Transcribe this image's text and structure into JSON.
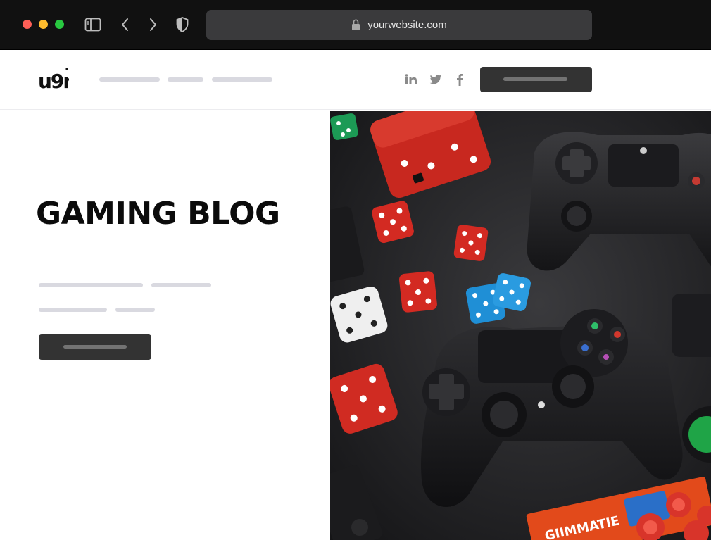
{
  "browser": {
    "url": "yourwebsite.com",
    "icons": [
      "sidebar-toggle-icon",
      "chevron-left-icon",
      "chevron-right-icon",
      "shield-icon",
      "lock-icon"
    ]
  },
  "site": {
    "logo_text": "u9n",
    "social": [
      "linkedin-icon",
      "twitter-icon",
      "facebook-icon"
    ]
  },
  "hero": {
    "title": "GAMING BLOG",
    "image_description": "black game controllers and colorful dice on a dark table",
    "image_text": "GIIMMATIE"
  },
  "colors": {
    "chrome_bg": "#111111",
    "address_bg": "#3a3a3c",
    "placeholder_bar": "#d9d9e0",
    "button_bg": "#333333",
    "title": "#0b0b0b"
  }
}
